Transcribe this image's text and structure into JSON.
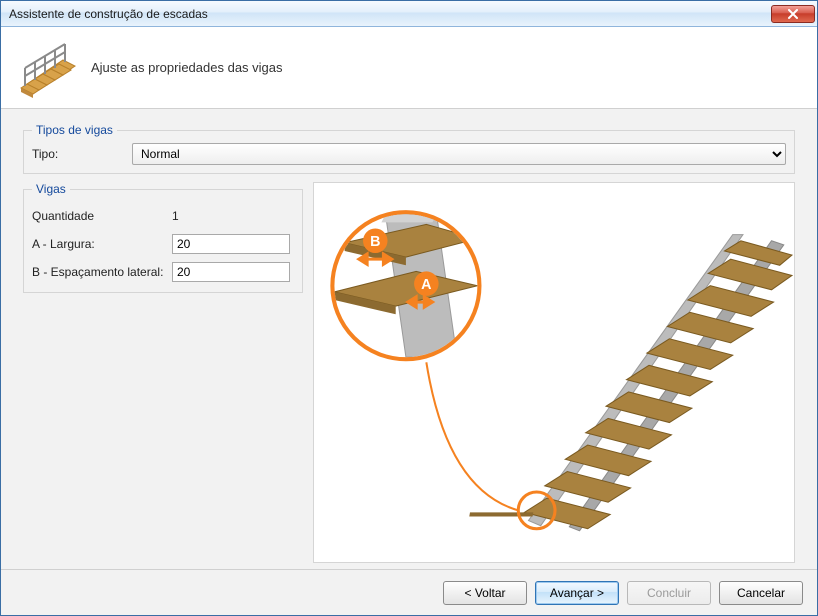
{
  "window": {
    "title": "Assistente de construção de escadas"
  },
  "header": {
    "heading": "Ajuste as propriedades das vigas"
  },
  "groups": {
    "tipos_de_vigas": {
      "legend": "Tipos de vigas",
      "tipo_label": "Tipo:",
      "tipo_value": "Normal"
    },
    "vigas": {
      "legend": "Vigas",
      "quantidade_label": "Quantidade",
      "quantidade_value": "1",
      "largura_label": "A - Largura:",
      "largura_value": "20",
      "espacamento_label": "B - Espaçamento lateral:",
      "espacamento_value": "20"
    }
  },
  "preview": {
    "callout_a": "A",
    "callout_b": "B"
  },
  "buttons": {
    "back": "< Voltar",
    "next": "Avançar >",
    "finish": "Concluir",
    "cancel": "Cancelar"
  },
  "colors": {
    "accent": "#f58220",
    "link_blue": "#14499c"
  }
}
